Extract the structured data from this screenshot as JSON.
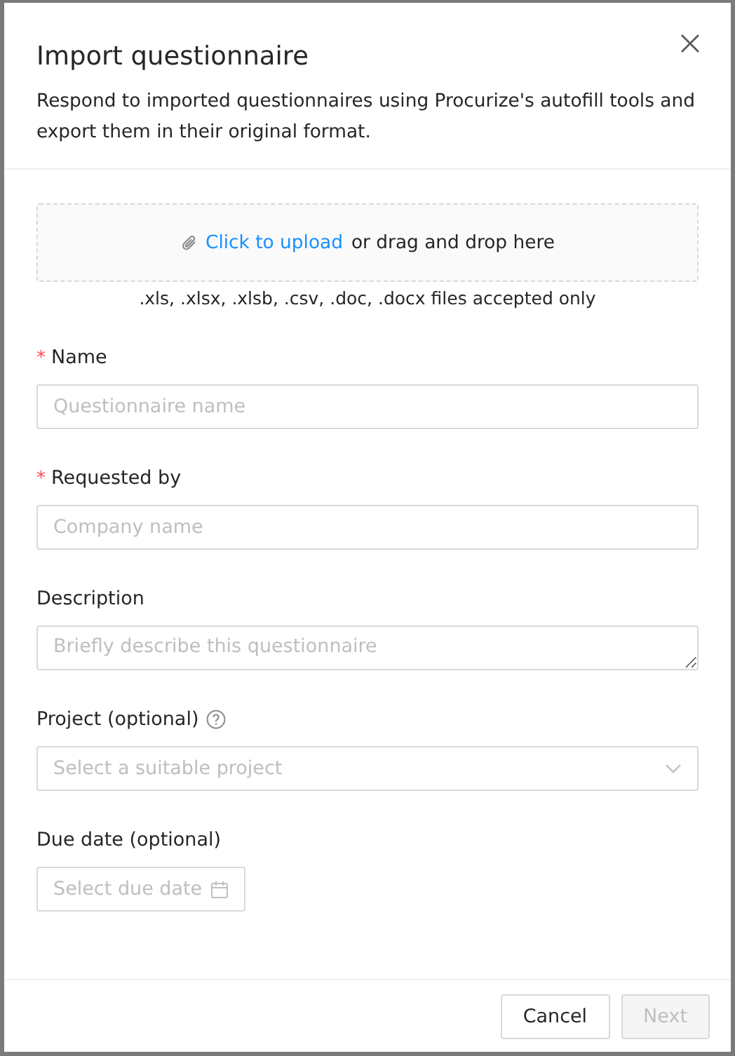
{
  "dialog": {
    "title": "Import questionnaire",
    "description": "Respond to imported questionnaires using Procurize's autofill tools and export them in their original format."
  },
  "upload": {
    "link": "Click to upload",
    "text": "or drag and drop here",
    "hint": ".xls, .xlsx, .xlsb, .csv, .doc, .docx files accepted only"
  },
  "fields": [
    {
      "kind": "text",
      "required_mark": "*",
      "label": "Name",
      "placeholder": "Questionnaire name"
    },
    {
      "kind": "text",
      "required_mark": "*",
      "label": "Requested by",
      "placeholder": "Company name"
    },
    {
      "kind": "textarea",
      "label": "Description",
      "placeholder": "Briefly describe this questionnaire"
    },
    {
      "kind": "select",
      "label": "Project (optional)",
      "help": true,
      "placeholder": "Select a suitable project"
    },
    {
      "kind": "date",
      "label": "Due date (optional)",
      "placeholder": "Select due date"
    }
  ],
  "buttons": [
    {
      "label": "Cancel",
      "disabled": false
    },
    {
      "label": "Next",
      "disabled": true
    }
  ]
}
